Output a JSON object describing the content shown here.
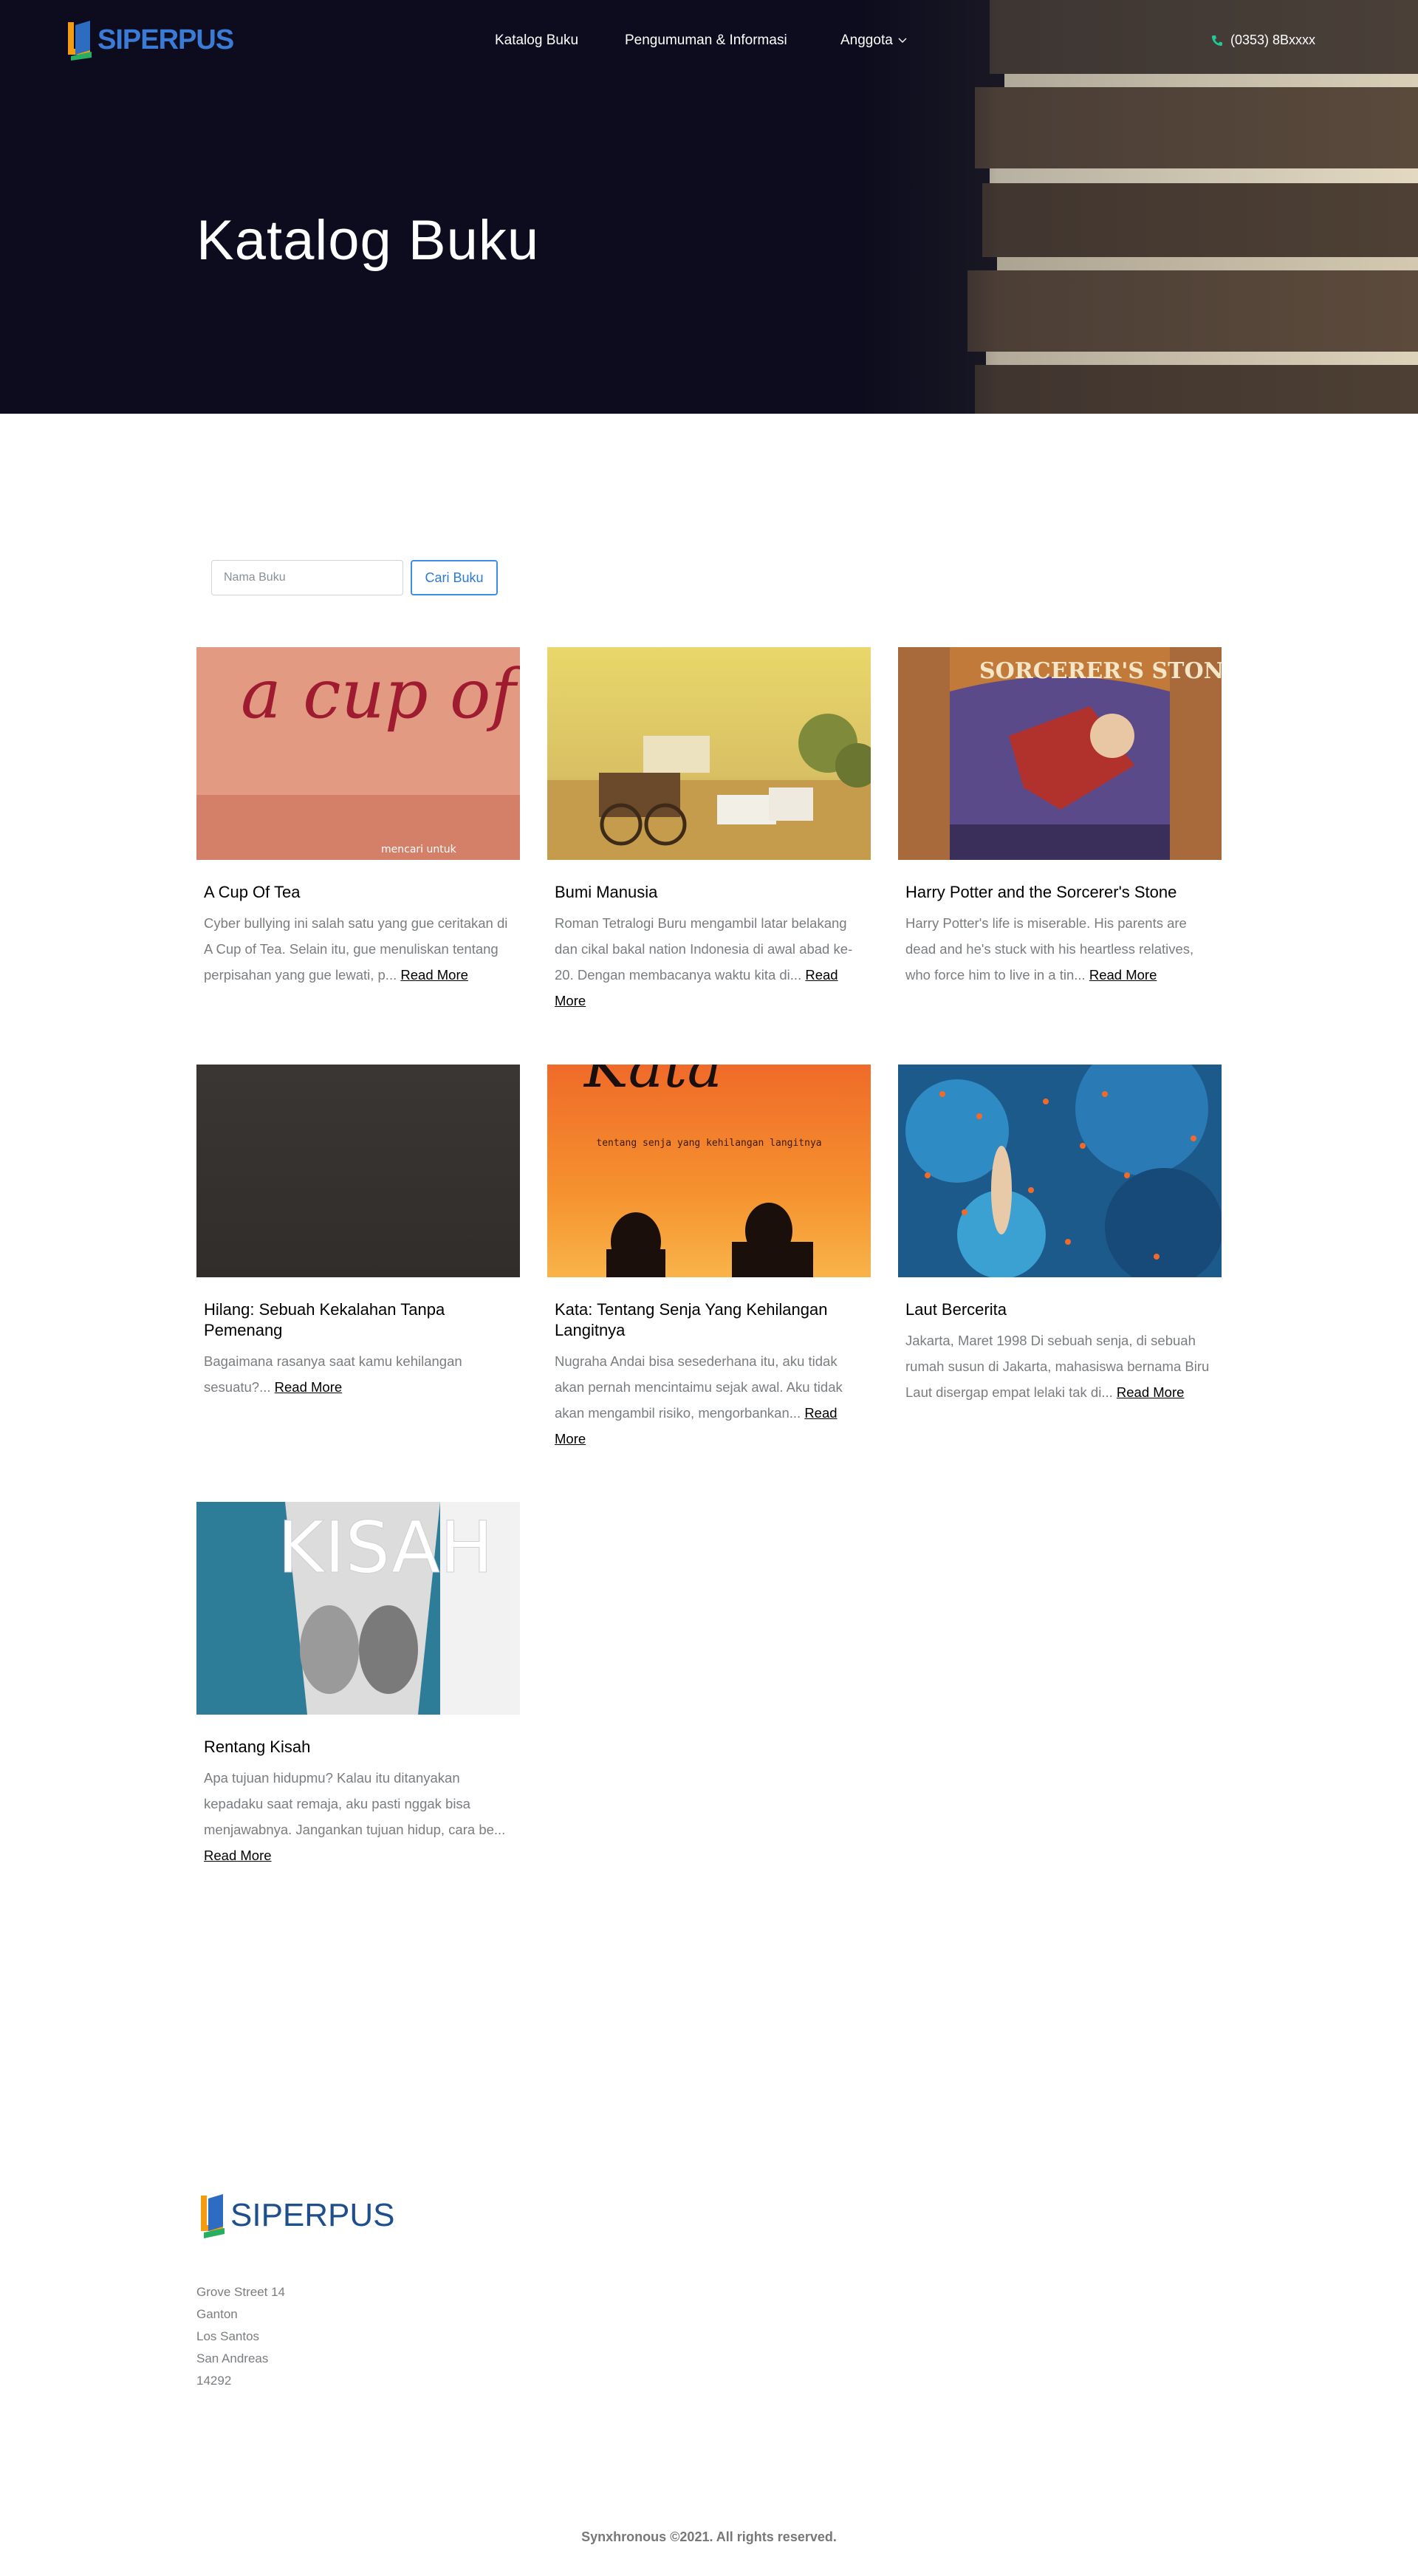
{
  "header": {
    "logo_text": "SIPERPUS",
    "nav": [
      {
        "label": "Katalog Buku"
      },
      {
        "label": "Pengumuman & Informasi"
      },
      {
        "label": "Anggota"
      }
    ],
    "phone": "(0353) 8Bxxxx",
    "phone_icon": "phone-icon",
    "dropdown_icon": "chevron-down-icon"
  },
  "hero": {
    "title": "Katalog Buku"
  },
  "search": {
    "placeholder": "Nama Buku",
    "value": "",
    "button_label": "Cari Buku"
  },
  "books": [
    {
      "title": "A Cup Of Tea",
      "description": "Cyber bullying ini salah satu yang gue ceritakan di A Cup of Tea. Selain itu, gue menuliskan tentang perpisahan yang gue lewati, p... ",
      "more": "Read More",
      "cover_text": "a cup of tea",
      "cover_subtext": "mencari untuk"
    },
    {
      "title": "Bumi Manusia",
      "description": "Roman Tetralogi Buru mengambil latar belakang dan cikal bakal nation Indonesia di awal abad ke-20. Dengan membacanya waktu kita di... ",
      "more": "Read More"
    },
    {
      "title": "Harry Potter and the Sorcerer's Stone",
      "description": "Harry Potter's life is miserable. His parents are dead and he's stuck with his heartless relatives, who force him to live in a tin... ",
      "more": "Read More",
      "cover_text": "SORCERER'S STONE"
    },
    {
      "title": "Hilang: Sebuah Kekalahan Tanpa Pemenang",
      "description": "Bagaimana rasanya saat kamu kehilangan sesuatu?... ",
      "more": "Read More"
    },
    {
      "title": "Kata: Tentang Senja Yang Kehilangan Langitnya",
      "description": "Nugraha Andai bisa sesederhana itu, aku tidak akan pernah mencintaimu sejak awal. Aku tidak akan mengambil risiko, mengorbankan... ",
      "more": "Read More",
      "cover_text": "Kata",
      "cover_subtext": "tentang senja yang kehilangan langitnya"
    },
    {
      "title": "Laut Bercerita",
      "description": "Jakarta, Maret 1998 Di sebuah senja, di sebuah rumah susun di Jakarta, mahasiswa bernama Biru Laut disergap empat lelaki tak di... ",
      "more": "Read More"
    },
    {
      "title": "Rentang Kisah",
      "description": "Apa tujuan hidupmu? Kalau itu ditanyakan kepadaku saat remaja, aku pasti nggak bisa menjawabnya. Jangankan tujuan hidup, cara be... ",
      "more": "Read More",
      "cover_text": "KISAH"
    }
  ],
  "footer": {
    "logo_text": "SIPERPUS",
    "address": [
      "Grove Street 14",
      "Ganton",
      "Los Santos",
      "San Andreas",
      "14292"
    ],
    "copyright": "Synxhronous ©2021. All rights reserved."
  },
  "colors": {
    "hero_bg": "#0c0c1e",
    "accent": "#3a8ee6",
    "logo_blue": "#1e4f8c",
    "text_muted": "#7a7d80"
  }
}
